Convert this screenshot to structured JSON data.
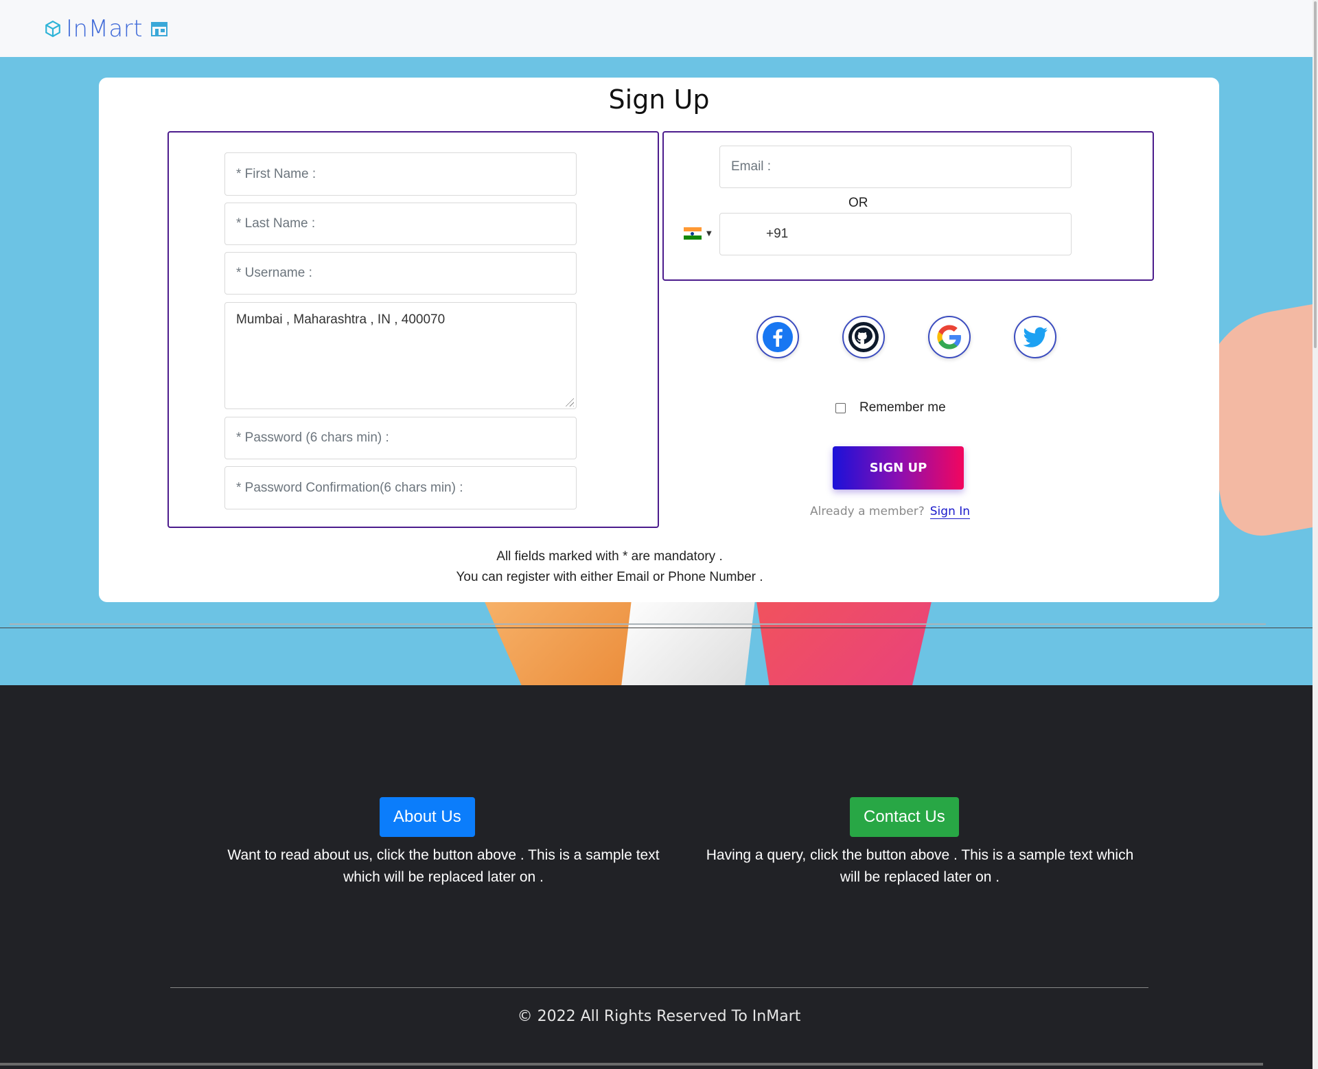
{
  "header": {
    "brand": "InMart"
  },
  "signup": {
    "title": "Sign Up",
    "fields": {
      "first_name_placeholder": "* First Name :",
      "last_name_placeholder": "* Last Name :",
      "username_placeholder": "* Username :",
      "address_value": "Mumbai , Maharashtra , IN , 400070",
      "password_placeholder": "* Password (6 chars min) :",
      "password_confirm_placeholder": "* Password Confirmation(6 chars min) :",
      "email_placeholder": "Email :",
      "phone_value": "+91"
    },
    "or_label": "OR",
    "social": [
      "facebook-icon",
      "github-icon",
      "google-icon",
      "twitter-icon"
    ],
    "remember_label": "Remember me",
    "remember_checked": false,
    "submit_label": "SIGN UP",
    "member_text": "Already a member?",
    "signin_link": "Sign In",
    "note_line1": "All fields marked with * are mandatory .",
    "note_line2": "You can register with either Email or Phone Number ."
  },
  "footer": {
    "about_button": "About Us",
    "about_text": "Want to read about us, click the button above . This is a sample text which will be replaced later on .",
    "contact_button": "Contact Us",
    "contact_text": "Having a query, click the button above . This is a sample text which will be replaced later on .",
    "copyright": "© 2022 All Rights Reserved To InMart"
  },
  "colors": {
    "accent_border": "#4b1b8c",
    "about_btn": "#0b7dfb",
    "contact_btn": "#28a745",
    "hero_bg": "#6cc3e4",
    "footer_bg": "#212226"
  }
}
